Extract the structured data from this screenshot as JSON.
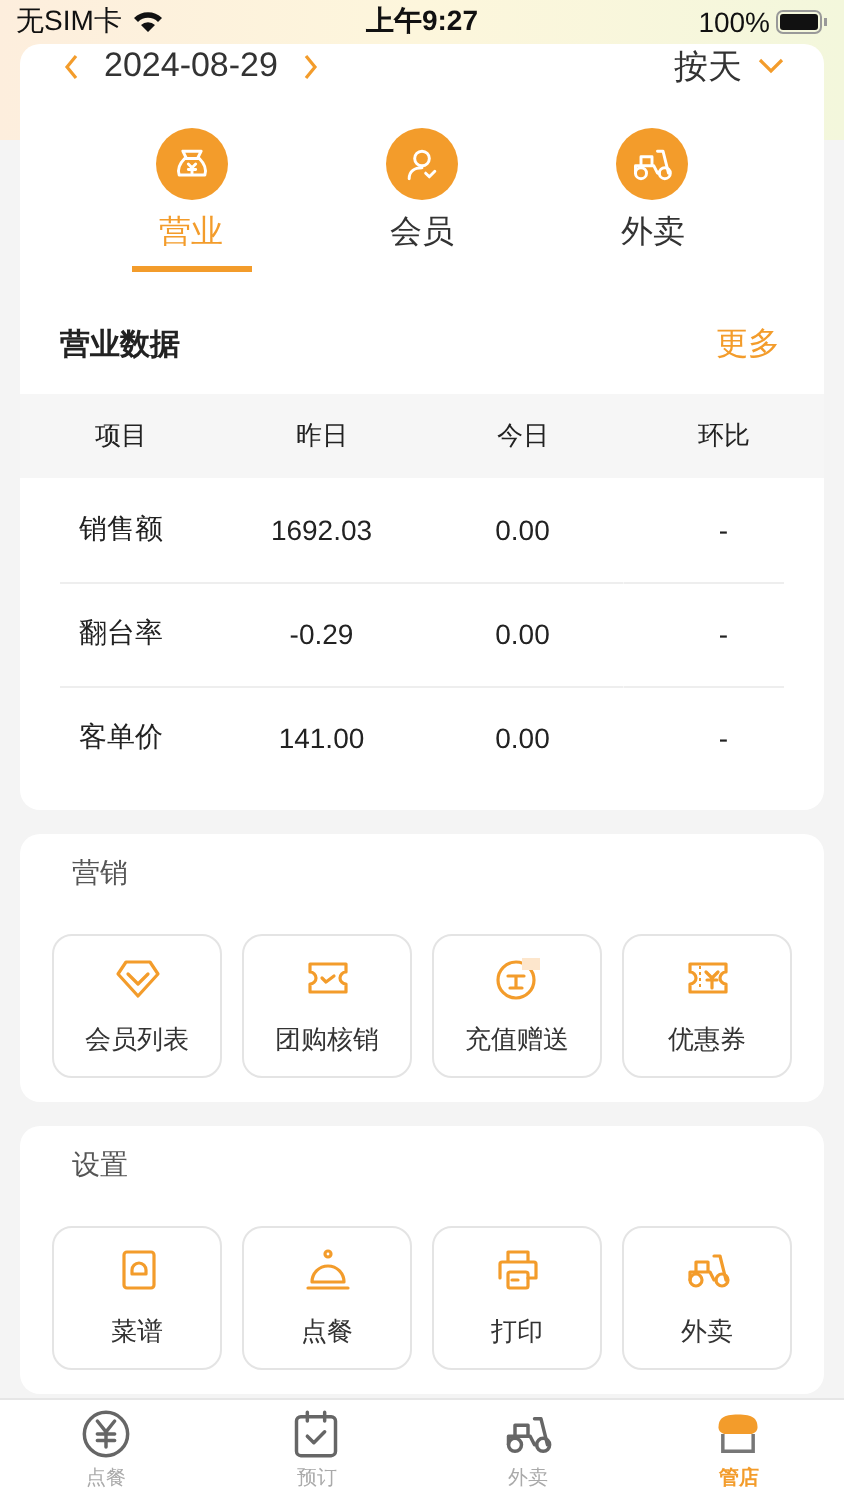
{
  "status_bar": {
    "carrier": "无SIM卡",
    "time": "上午9:27",
    "battery": "100%"
  },
  "date_bar": {
    "date": "2024-08-29",
    "period": "按天"
  },
  "category_tabs": [
    {
      "label": "营业",
      "selected": true
    },
    {
      "label": "会员",
      "selected": false
    },
    {
      "label": "外卖",
      "selected": false
    }
  ],
  "business_data": {
    "title": "营业数据",
    "more": "更多",
    "columns": [
      "项目",
      "昨日",
      "今日",
      "环比"
    ],
    "rows": [
      [
        "销售额",
        "1692.03",
        "0.00",
        "-"
      ],
      [
        "翻台率",
        "-0.29",
        "0.00",
        "-"
      ],
      [
        "客单价",
        "141.00",
        "0.00",
        "-"
      ]
    ]
  },
  "marketing": {
    "title": "营销",
    "items": [
      "会员列表",
      "团购核销",
      "充值赠送",
      "优惠券"
    ]
  },
  "settings": {
    "title": "设置",
    "items": [
      "菜谱",
      "点餐",
      "打印",
      "外卖"
    ]
  },
  "tab_bar": [
    {
      "label": "点餐",
      "selected": false
    },
    {
      "label": "预订",
      "selected": false
    },
    {
      "label": "外卖",
      "selected": false
    },
    {
      "label": "管店",
      "selected": true
    }
  ]
}
